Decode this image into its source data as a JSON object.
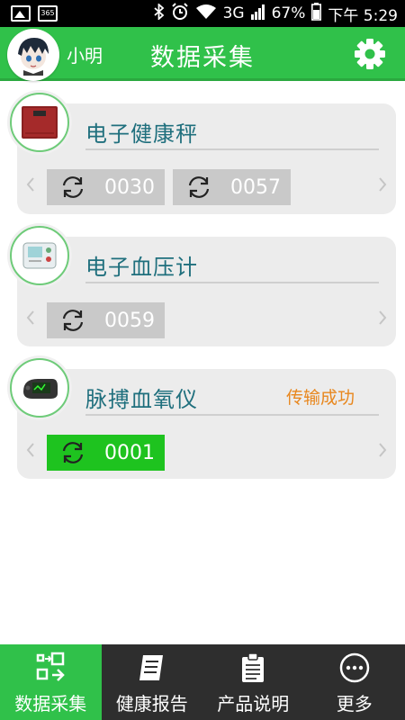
{
  "status_bar": {
    "calendar_day": "365",
    "network": "3G",
    "battery": "67%",
    "time": "下午 5:29"
  },
  "header": {
    "user_name": "小明",
    "title": "数据采集"
  },
  "devices": [
    {
      "name": "电子健康秤",
      "status": "",
      "records": [
        "0030",
        "0057"
      ]
    },
    {
      "name": "电子血压计",
      "status": "",
      "records": [
        "0059"
      ]
    },
    {
      "name": "脉搏血氧仪",
      "status": "传输成功",
      "records": [
        "0001"
      ]
    }
  ],
  "bottom_nav": [
    {
      "label": "数据采集",
      "icon": "data-collect-icon",
      "active": true
    },
    {
      "label": "健康报告",
      "icon": "report-icon",
      "active": false
    },
    {
      "label": "产品说明",
      "icon": "manual-icon",
      "active": false
    },
    {
      "label": "更多",
      "icon": "more-icon",
      "active": false
    }
  ],
  "colors": {
    "primary_green": "#30c14a",
    "active_record": "#1ec31f",
    "device_name": "#1f6f7d",
    "status_orange": "#e8871e"
  }
}
